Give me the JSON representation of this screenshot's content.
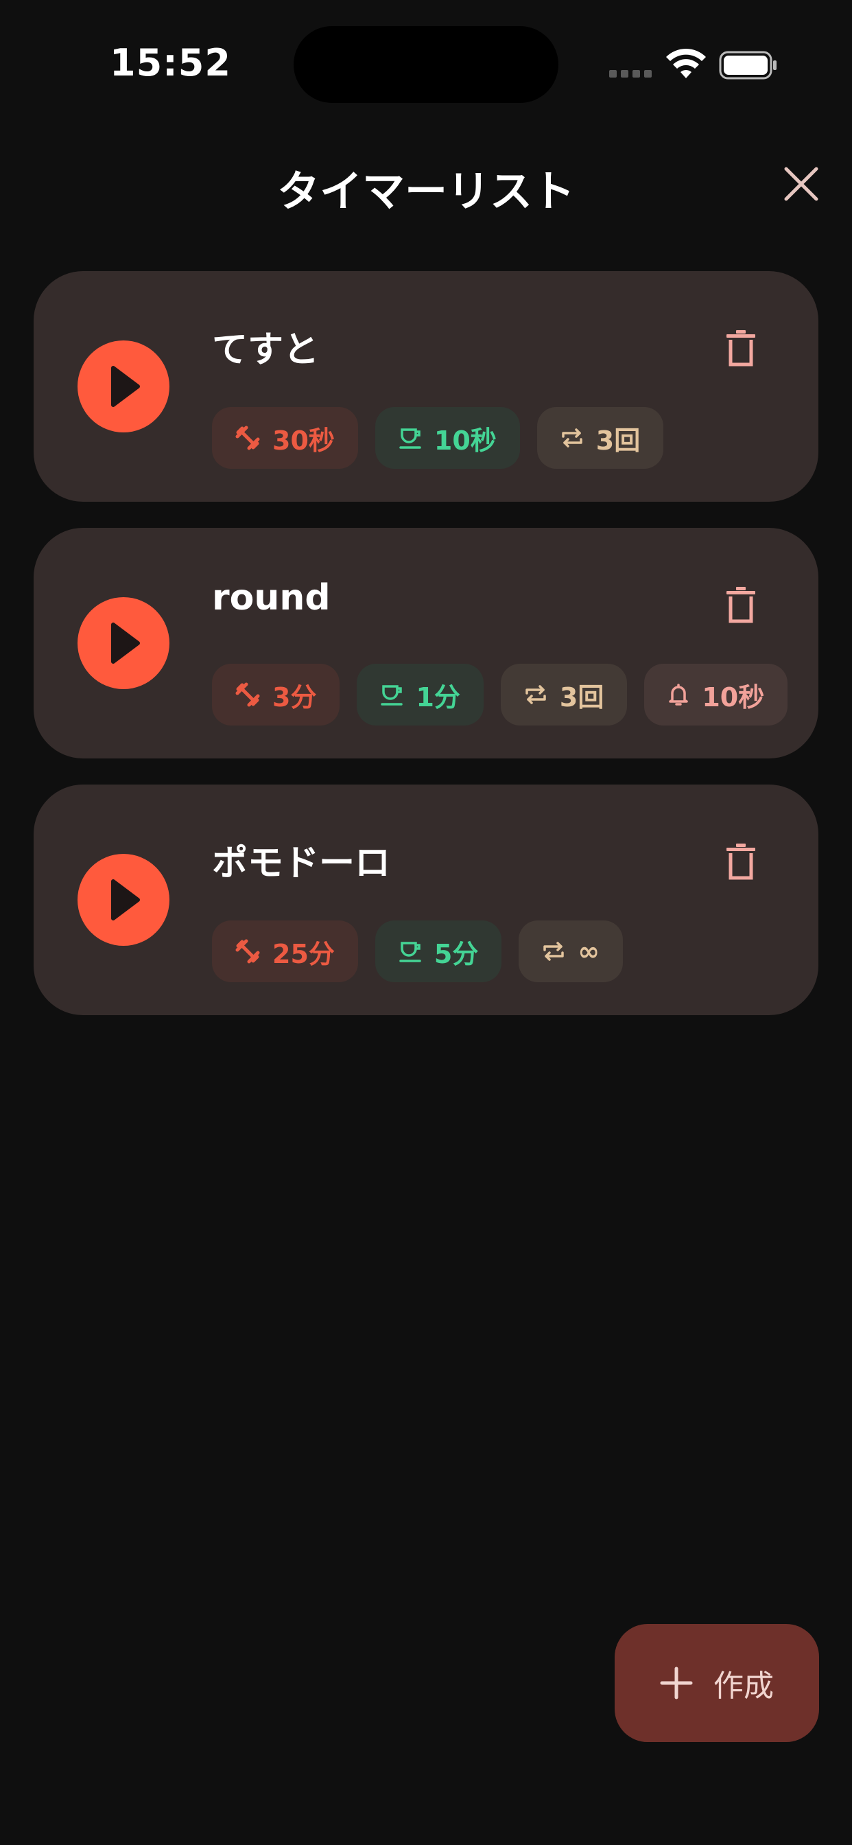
{
  "status_bar": {
    "time": "15:52"
  },
  "header": {
    "title": "タイマーリスト"
  },
  "colors": {
    "background": "#0f0f0f",
    "card": "#352c2b",
    "accent": "#ff5a3d",
    "work": "#ec5a42",
    "rest": "#44d495",
    "loop": "#e3c49d",
    "bell": "#f2a29a",
    "fab": "#6e302a"
  },
  "timers": [
    {
      "name": "てすと",
      "work": "30秒",
      "rest": "10秒",
      "repeat": "3回"
    },
    {
      "name": "round",
      "work": "3分",
      "rest": "1分",
      "repeat": "3回",
      "notify": "10秒"
    },
    {
      "name": "ポモドーロ",
      "work": "25分",
      "rest": "5分",
      "repeat": "∞"
    }
  ],
  "fab": {
    "label": "作成",
    "icon": "plus-icon"
  }
}
